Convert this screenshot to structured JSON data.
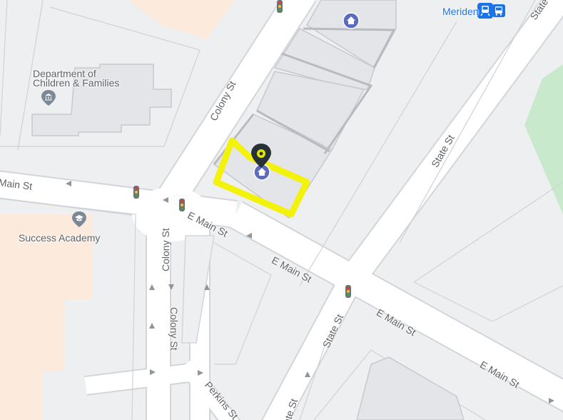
{
  "map": {
    "labels": {
      "main_st_left": "Main St",
      "e_main_st_1": "E Main St",
      "e_main_st_2": "E Main St",
      "e_main_st_3": "E Main St",
      "e_main_st_4": "E Main St",
      "colony_st_top": "Colony St",
      "colony_st_mid": "Colony St",
      "colony_st_low": "Colony St",
      "state_st_right": "State St",
      "state_st_low": "State St",
      "state_st_bottom": "State St",
      "state_st_topright": "State St",
      "perkins_st": "Perkins St",
      "poi_dcf_line1": "Department of",
      "poi_dcf_line2": "Children & Families",
      "poi_success": "Success Academy",
      "transit_meriden": "Meriden"
    },
    "colors": {
      "background": "#eeeff1",
      "road": "#ffffff",
      "road_edge": "#cfd3d8",
      "building": "#e4e5e8",
      "building_edge": "#c6c9cd",
      "park": "#c9e9cc",
      "commercial": "#fcebdc",
      "highlight": "#f2f20a",
      "pin": "#263238",
      "poi_gray": "#7d8896",
      "transit_blue": "#1a73e8"
    },
    "icons": [
      "home-icon",
      "government-building-icon",
      "school-icon",
      "traffic-light-icon",
      "bus-icon",
      "train-icon",
      "location-pin-icon",
      "one-way-arrow-icon"
    ]
  }
}
